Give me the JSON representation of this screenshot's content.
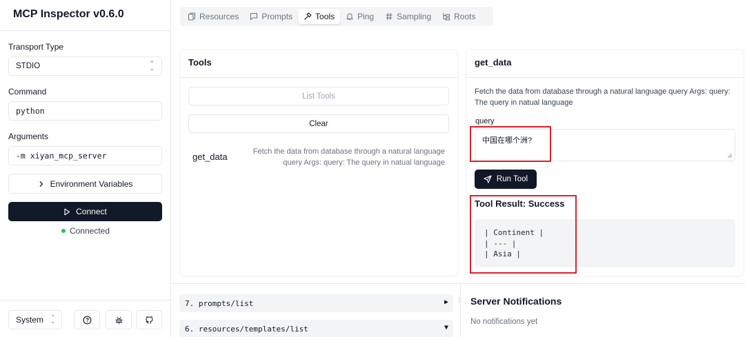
{
  "app": {
    "title": "MCP Inspector v0.6.0"
  },
  "sidebar": {
    "transport_label": "Transport Type",
    "transport_value": "STDIO",
    "command_label": "Command",
    "command_value": "python",
    "arguments_label": "Arguments",
    "arguments_value": "-m xiyan_mcp_server",
    "env_label": "Environment Variables",
    "connect_label": "Connect",
    "status_text": "Connected",
    "theme_value": "System"
  },
  "tabs": [
    {
      "label": "Resources",
      "icon": "files-icon",
      "active": false
    },
    {
      "label": "Prompts",
      "icon": "message-square-icon",
      "active": false
    },
    {
      "label": "Tools",
      "icon": "hammer-icon",
      "active": true
    },
    {
      "label": "Ping",
      "icon": "bell-icon",
      "active": false
    },
    {
      "label": "Sampling",
      "icon": "hash-icon",
      "active": false
    },
    {
      "label": "Roots",
      "icon": "folder-tree-icon",
      "active": false
    }
  ],
  "tools_panel": {
    "title": "Tools",
    "list_tools_label": "List Tools",
    "clear_label": "Clear",
    "tool_name": "get_data",
    "tool_desc": "Fetch the data from database through a natural language query Args: query: The query in natual language"
  },
  "detail_panel": {
    "title": "get_data",
    "description": "Fetch the data from database through a natural language query Args: query: The query in natual language",
    "query_label": "query",
    "query_value": "中国在哪个洲?",
    "run_label": "Run Tool",
    "result_title": "Tool Result: Success",
    "result_lines": [
      "| Continent |",
      "| --- |",
      "| Asia |"
    ]
  },
  "history": [
    {
      "label": "7. prompts/list",
      "arrow": "▶"
    },
    {
      "label": "6. resources/templates/list",
      "arrow": "▼"
    }
  ],
  "notifications": {
    "title": "Server Notifications",
    "empty_text": "No notifications yet"
  },
  "colors": {
    "primary": "#111827",
    "status_green": "#22c55e",
    "annotation_red": "#e11d2a",
    "muted_bg": "#f3f4f6"
  }
}
